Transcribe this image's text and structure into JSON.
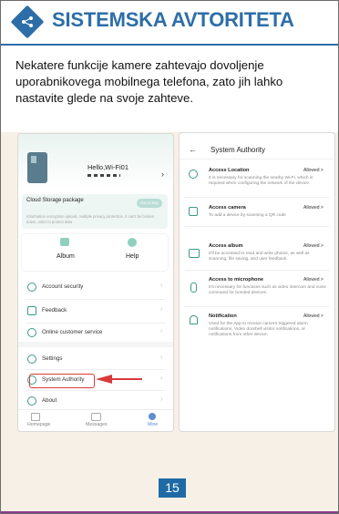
{
  "header": {
    "title": "SISTEMSKA AVTORITETA"
  },
  "intro": {
    "text": "Nekatere funkcije kamere zahtevajo dovoljenje uporabnikovega mobilnega telefona, zato jih lahko nastavite glede na svoje zahteve."
  },
  "left_phone": {
    "profile_name": "Hello,Wi-Fi01",
    "cloud_title": "Cloud Storage package",
    "cloud_button": "Go to buy",
    "cloud_desc": "Information encryption upload, multiple privacy protection. It can't be broken down, order to protect data",
    "shortcut_album": "Album",
    "shortcut_help": "Help",
    "menu": [
      "Account security",
      "Feedback",
      "Online customer service",
      "Settings",
      "System Authority",
      "About"
    ],
    "tabs": [
      "Homepage",
      "Messages",
      "Mine"
    ]
  },
  "right_phone": {
    "title": "System Authority",
    "back": "←",
    "items": [
      {
        "title": "Access Location",
        "status": "Allowed >",
        "desc": "It is necessary for scanning the nearby Wi-Fi, which is required when configuring the network of the device."
      },
      {
        "title": "Access camera",
        "status": "Allowed >",
        "desc": "To add a device by scanning a QR code"
      },
      {
        "title": "Access album",
        "status": "Allowed >",
        "desc": "It'll be accessed to read and write photos, as well as scanning, file saving, and user feedback."
      },
      {
        "title": "Access to microphone",
        "status": "Allowed >",
        "desc": "It's necessary for functions such as video intercom and voice command for bonded devices."
      },
      {
        "title": "Notification",
        "status": "Allowed >",
        "desc": "Used for the App to receive camera triggered alarm notifications, Video doorbell visitor notifications, or notifications from other device."
      }
    ]
  },
  "page_number": "15",
  "colors": {
    "accent": "#2d6ea8",
    "highlight": "#d9393b",
    "teal": "#3a9a8a"
  }
}
